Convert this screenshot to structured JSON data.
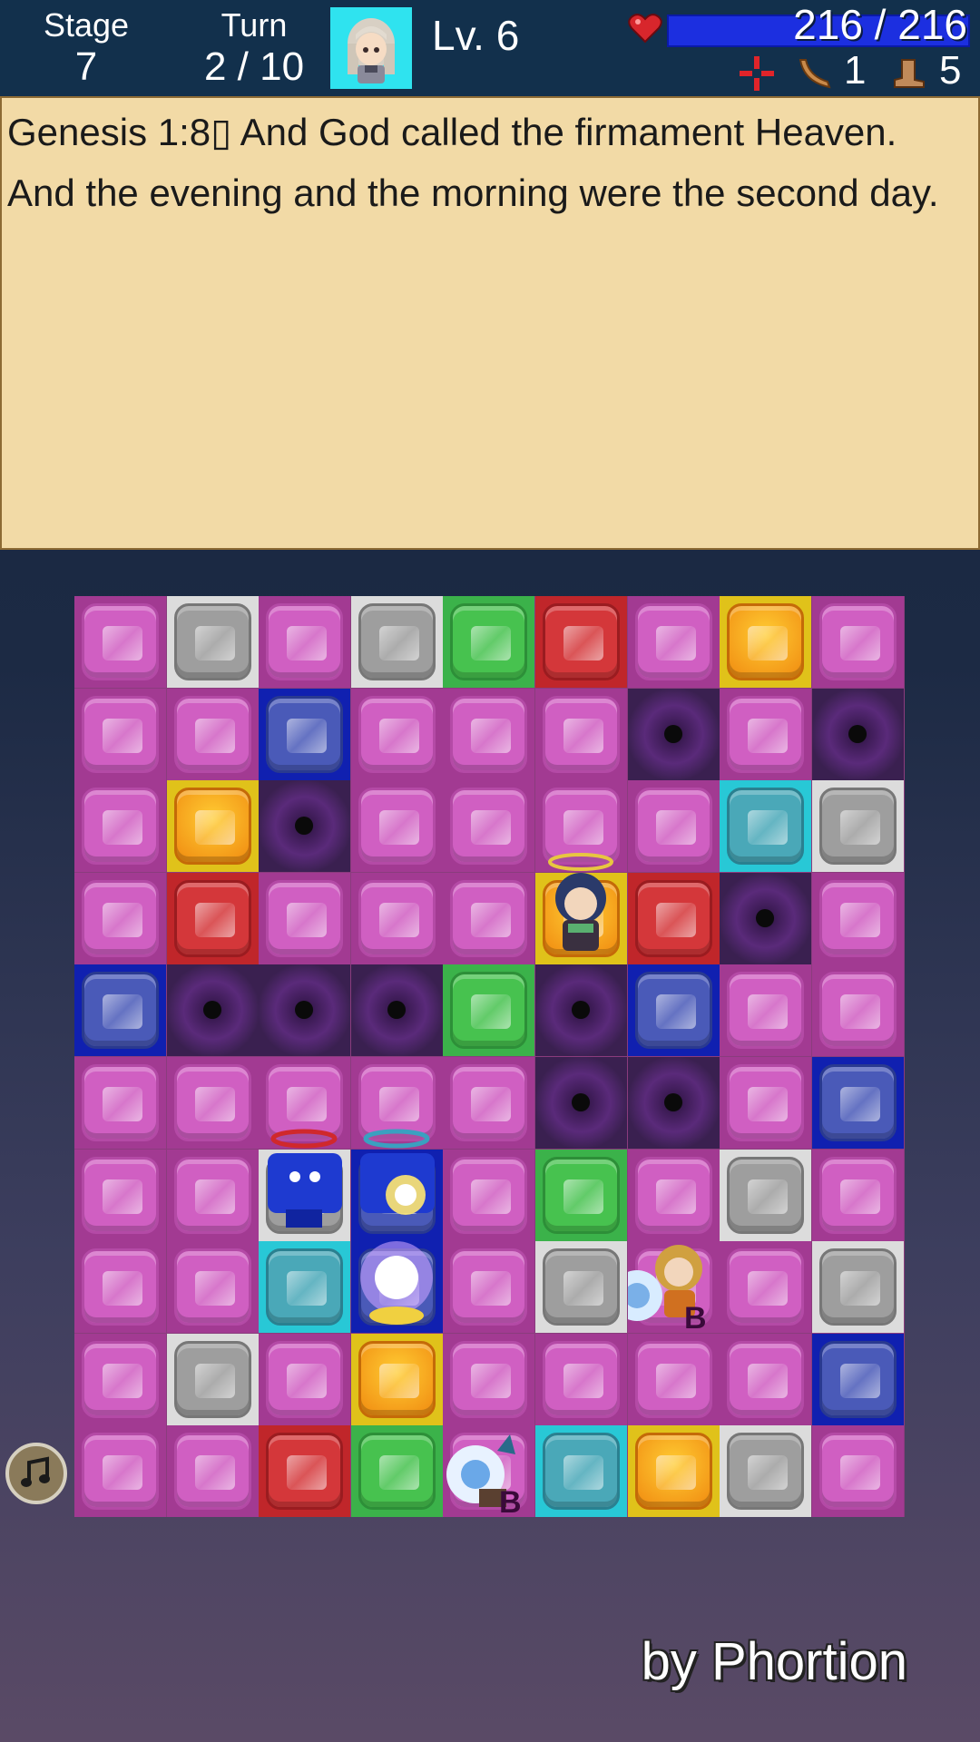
{
  "hud": {
    "stage_label": "Stage",
    "stage_value": "7",
    "turn_label": "Turn",
    "turn_value": "2 / 10",
    "level": "Lv. 6",
    "hp_current": "216",
    "hp_separator": " / ",
    "hp_max": "216",
    "hp_fraction": 1.0,
    "boomerang_count": "1",
    "boot_count": "5"
  },
  "verse": {
    "text": "Genesis 1:8▯ And God called the firmament Heaven. And the evening and the morning were the second day."
  },
  "board": {
    "cols": 9,
    "rows": 10,
    "cells": [
      [
        "pink",
        "gray",
        "pink",
        "gray",
        "green",
        "red",
        "pink",
        "orange",
        "pink"
      ],
      [
        "pink",
        "pink",
        "blue",
        "pink",
        "pink",
        "pink",
        "vortex",
        "pink",
        "vortex"
      ],
      [
        "pink",
        "orange",
        "vortex",
        "pink",
        "pink",
        "pink",
        "pink",
        "teal",
        "gray"
      ],
      [
        "pink",
        "red",
        "pink",
        "pink",
        "pink",
        "orange",
        "red",
        "vortex",
        "pink"
      ],
      [
        "blue",
        "vortex",
        "vortex",
        "vortex",
        "green",
        "vortex",
        "blue",
        "pink",
        "pink"
      ],
      [
        "pink",
        "pink",
        "pink",
        "pink",
        "pink",
        "vortex",
        "vortex",
        "pink",
        "blue"
      ],
      [
        "pink",
        "pink",
        "gray",
        "blue",
        "pink",
        "green",
        "pink",
        "gray",
        "pink"
      ],
      [
        "pink",
        "pink",
        "teal",
        "blue",
        "pink",
        "gray",
        "pink",
        "pink",
        "gray"
      ],
      [
        "pink",
        "gray",
        "pink",
        "orange",
        "pink",
        "pink",
        "pink",
        "pink",
        "blue"
      ],
      [
        "pink",
        "pink",
        "red",
        "green",
        "pink",
        "teal",
        "orange",
        "gray",
        "pink"
      ]
    ]
  },
  "units": {
    "enemy_b_label": "B"
  },
  "colors": {
    "hp_bar": "#1c2fe0",
    "portrait_bg": "#2fe3ef",
    "verse_bg": "#f2daa6",
    "board_bg": "#8a3c7d"
  },
  "credit": "by Phortion"
}
